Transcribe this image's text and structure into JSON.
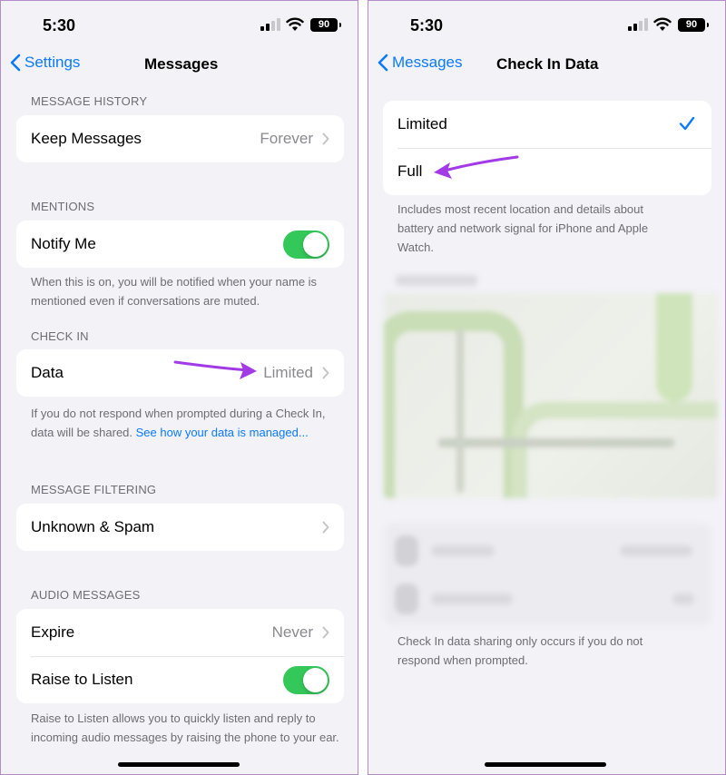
{
  "status": {
    "time": "5:30",
    "battery": "90"
  },
  "left": {
    "nav": {
      "back_label": "Settings",
      "title": "Messages"
    },
    "sections": {
      "message_history": "MESSAGE HISTORY",
      "mentions": "MENTIONS",
      "check_in": "CHECK IN",
      "message_filtering": "MESSAGE FILTERING",
      "audio_messages": "AUDIO MESSAGES"
    },
    "rows": {
      "keep_messages": {
        "label": "Keep Messages",
        "value": "Forever"
      },
      "notify_me": {
        "label": "Notify Me",
        "toggle_on": true
      },
      "data": {
        "label": "Data",
        "value": "Limited"
      },
      "unknown_spam": {
        "label": "Unknown & Spam"
      },
      "expire": {
        "label": "Expire",
        "value": "Never"
      },
      "raise_to_listen": {
        "label": "Raise to Listen",
        "toggle_on": true
      }
    },
    "footnotes": {
      "mentions": "When this is on, you will be notified when your name is mentioned even if conversations are muted.",
      "check_in_text": "If you do not respond when prompted during a Check In, data will be shared. ",
      "check_in_link": "See how your data is managed...",
      "audio": "Raise to Listen allows you to quickly listen and reply to incoming audio messages by raising the phone to your ear."
    }
  },
  "right": {
    "nav": {
      "back_label": "Messages",
      "title": "Check In Data"
    },
    "options": [
      {
        "label": "Limited",
        "selected": true
      },
      {
        "label": "Full",
        "selected": false
      }
    ],
    "description": "Includes most recent location and details about battery and network signal for iPhone and Apple Watch.",
    "footer": "Check In data sharing only occurs if you do not respond when prompted."
  },
  "colors": {
    "accent": "#0a7aff",
    "toggle_on": "#34c759",
    "annotation_arrow": "#a23be6",
    "background": "#f2f2f7"
  },
  "icons": [
    "chevron-left-icon",
    "chevron-right-icon",
    "checkmark-icon",
    "signal-icon",
    "wifi-icon",
    "battery-icon",
    "annotation-arrow"
  ]
}
